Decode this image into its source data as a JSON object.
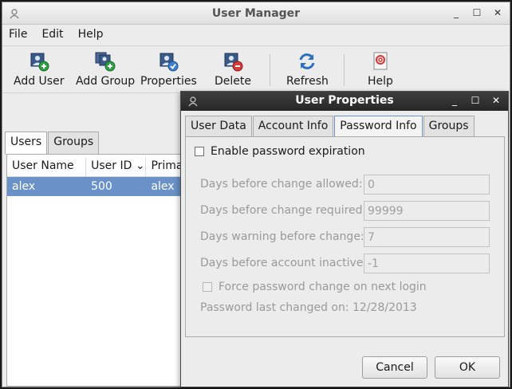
{
  "main_window": {
    "title": "User Manager",
    "menu": [
      "File",
      "Edit",
      "Help"
    ],
    "toolbar": {
      "add_user": "Add User",
      "add_group": "Add Group",
      "properties": "Properties",
      "delete": "Delete",
      "refresh": "Refresh",
      "help": "Help"
    },
    "tabs": [
      "Users",
      "Groups"
    ],
    "columns": [
      "User Name",
      "User ID",
      "Prima"
    ],
    "sort_indicator": "⌄",
    "rows": [
      {
        "user_name": "alex",
        "user_id": "500",
        "primary": "alex"
      }
    ]
  },
  "dialog": {
    "title": "User Properties",
    "tabs": [
      "User Data",
      "Account Info",
      "Password Info",
      "Groups"
    ],
    "active_tab": "Password Info",
    "enable_expiration_label": "Enable password expiration",
    "fields": {
      "days_before_change_allowed": {
        "label": "Days before change allowed:",
        "value": "0"
      },
      "days_before_change_required": {
        "label": "Days before change required:",
        "value": "99999"
      },
      "days_warning": {
        "label": "Days warning before change:",
        "value": "7"
      },
      "days_inactive": {
        "label": "Days before account inactive:",
        "value": "-1"
      }
    },
    "force_change_label": "Force password change on next login",
    "last_changed_text": "Password last changed on: 12/28/2013",
    "cancel_label": "Cancel",
    "ok_label": "OK"
  },
  "window_controls": {
    "minimize": "_",
    "maximize": "☐",
    "close": "✕"
  },
  "colors": {
    "selection": "#6b92c8",
    "dialog_titlebar": "#2f2f2f"
  }
}
